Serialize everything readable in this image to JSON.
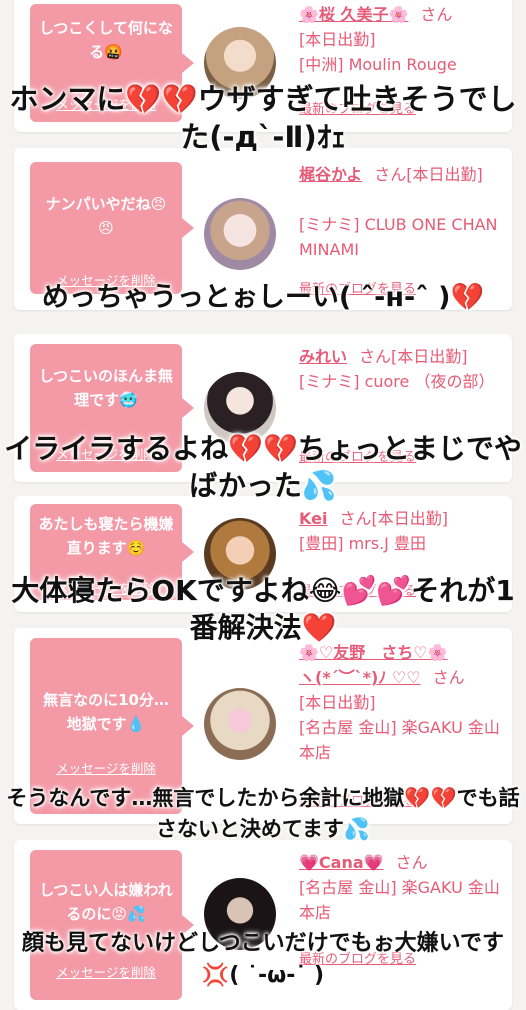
{
  "cards": [
    {
      "message": "しつこくして何になる🤬",
      "delete_label": "メッセージを削除",
      "name": "🌸桜 久美子🌸",
      "san": "さん",
      "status": "[本日出勤]",
      "area": "[中洲] Moulin Rouge",
      "blog": "最新のブログを見る"
    },
    {
      "message": "ナンパいやだね😠😠",
      "delete_label": "メッセージを削除",
      "name": "梶谷かよ",
      "san": "さん",
      "status": "[本日出勤]",
      "area": "[ミナミ] CLUB ONE CHAN MINAMI",
      "blog": "最新のブログを見る"
    },
    {
      "message": "しつこいのほんま無理です🥶",
      "delete_label": "メッセージを削除",
      "name": "みれい",
      "san": "さん",
      "status": "[本日出勤]",
      "area": "[ミナミ] cuore （夜の部）",
      "blog": "最新のブログを見る"
    },
    {
      "message": "あたしも寝たら機嫌直ります☺️",
      "delete_label": "メッセージを削除",
      "name": "Kei",
      "san": "さん",
      "status": "[本日出勤]",
      "area": "[豊田] mrs.J 豊田",
      "blog": "最新のブログを見る"
    },
    {
      "message": "無言なのに10分…地獄です💧",
      "delete_label": "メッセージを削除",
      "name": "🌸♡友野　さち♡🌸",
      "name2": "ヽ(*´︶`*)ﾉ ♡♡",
      "san": "さん",
      "status": "[本日出勤]",
      "area": "[名古屋 金山] 楽GAKU 金山本店",
      "blog": "最新のブログを見る"
    },
    {
      "message": "しつこい人は嫌われるのに😡💦",
      "delete_label": "メッセージを削除",
      "name": "💗Cana💗",
      "san": "さん",
      "area": "[名古屋 金山] 楽GAKU 金山本店",
      "blog": "最新のブログを見る"
    }
  ],
  "captions": [
    "ホンマに💔💔ウザすぎて吐きそうでした(-д`-Ⅱ)ｵｪ",
    "めっちゃうっとぉしーい( ˆ-н-ˆ )💔",
    "イライラするよね💔💔ちょっとまじでやばかった💦",
    "大体寝たらOKですよね😂💕💕それが1番解決法❤️",
    "そうなんです…無言でしたから余計に地獄💔💔でも話さないと決めてます💦",
    "顔も見てないけどしつこいだけでもぉ大嫌いです💢( ˙-ω-˙ )"
  ],
  "colors": {
    "accent": "#e65b77",
    "bubble": "#f39aa6",
    "background": "#f4f3f2"
  },
  "icons": [
    "avatar-photo"
  ]
}
